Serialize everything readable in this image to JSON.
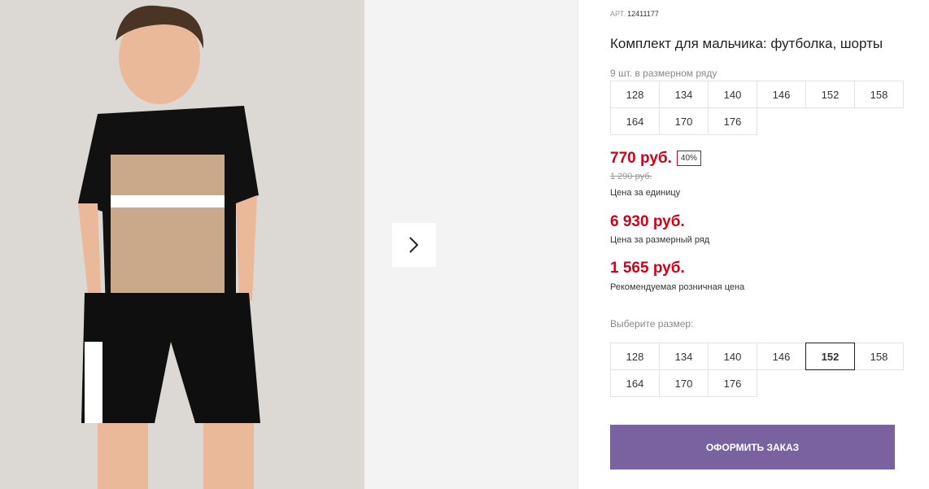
{
  "product": {
    "sku_label": "АРТ.",
    "sku": "12411177",
    "title": "Комплект для мальчика: футболка, шорты"
  },
  "size_row": {
    "caption": "9 шт. в размерном ряду",
    "sizes": [
      "128",
      "134",
      "140",
      "146",
      "152",
      "158",
      "164",
      "170",
      "176"
    ]
  },
  "prices": {
    "unit_price": "770 руб.",
    "discount_badge": "40%",
    "old_price": "1 290 руб.",
    "unit_note": "Цена за единицу",
    "row_price": "6 930 руб.",
    "row_note": "Цена за размерный ряд",
    "retail_price": "1 565 руб.",
    "retail_note": "Рекомендуемая розничная цена"
  },
  "size_select": {
    "caption": "Выберите размер:",
    "sizes": [
      "128",
      "134",
      "140",
      "146",
      "152",
      "158",
      "164",
      "170",
      "176"
    ],
    "selected": "152"
  },
  "order_button": "ОФОРМИТЬ ЗАКАЗ",
  "icons": {
    "next": "chevron-right-icon"
  },
  "colors": {
    "price": "#d0021b",
    "accent": "#7a62a0"
  }
}
